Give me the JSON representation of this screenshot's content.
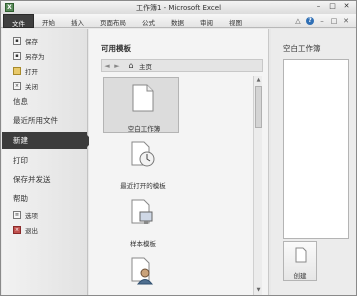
{
  "window": {
    "title": "工作簿1 - Microsoft Excel",
    "app_icon": "X",
    "controls": [
      "–",
      "□",
      "✕"
    ]
  },
  "ribbon": {
    "tabs": [
      "文件",
      "开始",
      "插入",
      "页面布局",
      "公式",
      "数据",
      "审阅",
      "视图"
    ],
    "help_icons": [
      "△",
      "?",
      "–",
      "□",
      "✕"
    ]
  },
  "backstage": {
    "items_top": [
      {
        "label": "保存",
        "icon": "save-icon"
      },
      {
        "label": "另存为",
        "icon": "save-as-icon"
      },
      {
        "label": "打开",
        "icon": "open-icon"
      },
      {
        "label": "关闭",
        "icon": "close-doc-icon"
      }
    ],
    "info": "信息",
    "recent": "最近所用文件",
    "new": "新建",
    "print": "打印",
    "save_send": "保存并发送",
    "help": "帮助",
    "items_bottom": [
      {
        "label": "选项",
        "icon": "options-icon"
      },
      {
        "label": "退出",
        "icon": "exit-icon"
      }
    ]
  },
  "templates_panel": {
    "title": "可用模板",
    "nav": {
      "back": "◄",
      "forward": "►",
      "home_label": "主页"
    },
    "items": [
      {
        "label": "空白工作簿",
        "icon": "blank-workbook-icon",
        "selected": true
      },
      {
        "label": "最近打开的模板",
        "icon": "recent-templates-icon",
        "selected": false
      },
      {
        "label": "样本模板",
        "icon": "sample-templates-icon",
        "selected": false
      },
      {
        "label": "",
        "icon": "my-templates-icon",
        "selected": false
      }
    ]
  },
  "preview": {
    "title": "空白工作簿",
    "create_label": "创建"
  }
}
